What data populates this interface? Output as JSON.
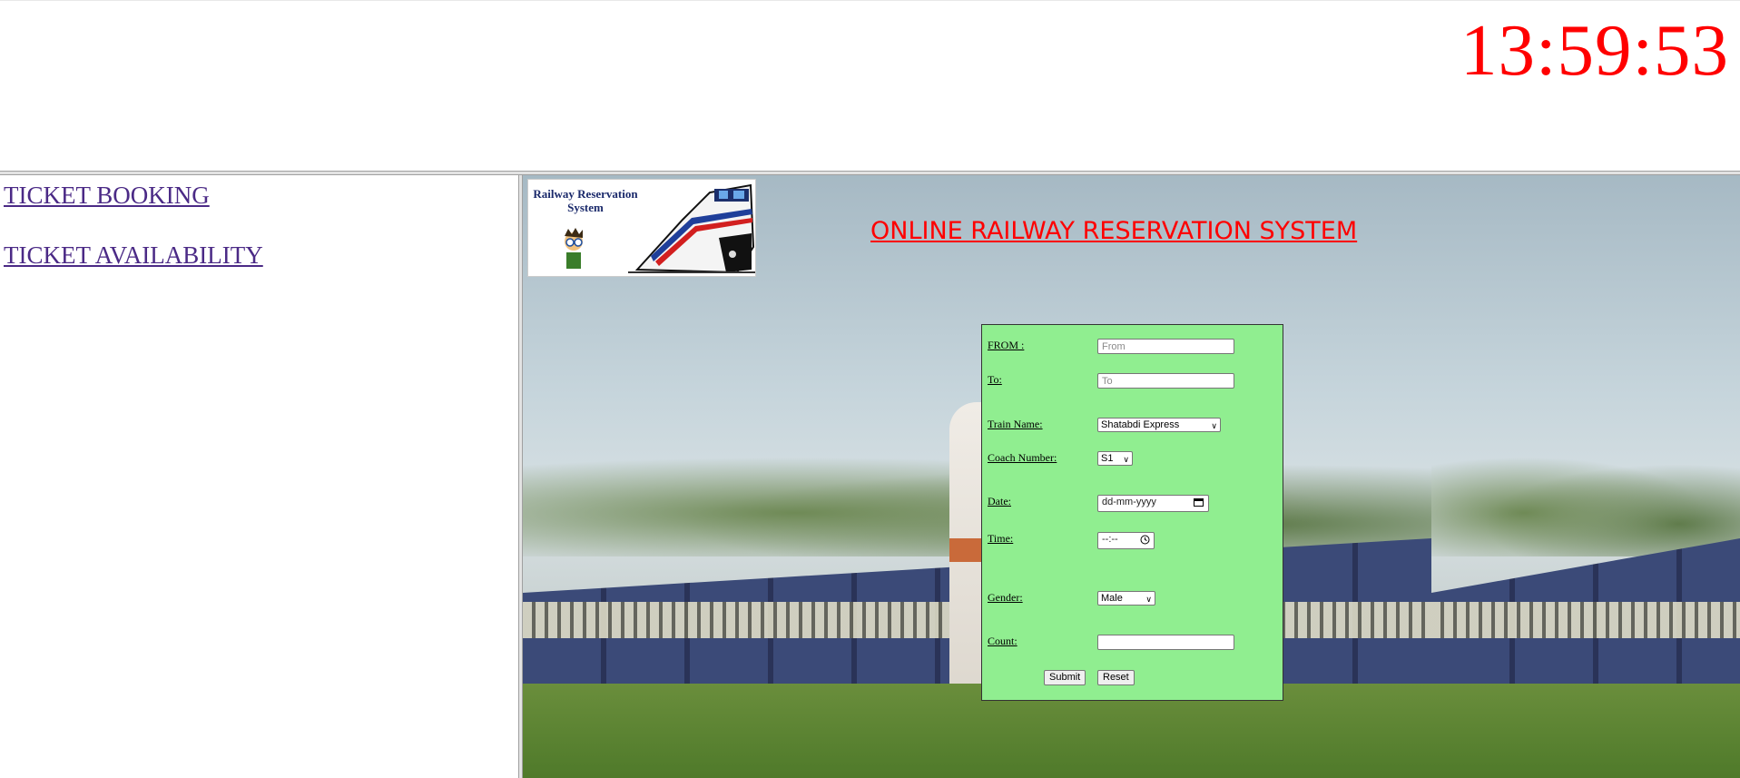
{
  "header": {
    "clock": "13:59:53"
  },
  "nav": {
    "booking": "TICKET BOOKING",
    "availability": "TICKET AVAILABILITY"
  },
  "main": {
    "logo_title": "Railway Reservation System",
    "title": "ONLINE RAILWAY RESERVATION SYSTEM"
  },
  "form": {
    "from_label": "FROM :",
    "from_placeholder": "From",
    "to_label": "To:",
    "to_placeholder": "To",
    "train_label": "Train Name:",
    "train_value": "Shatabdi Express",
    "coach_label": "Coach Number:",
    "coach_value": "S1",
    "date_label": "Date:",
    "date_placeholder": "dd-mm-yyyy",
    "time_label": "Time:",
    "time_placeholder": "--:--",
    "gender_label": "Gender:",
    "gender_value": "Male",
    "count_label": "Count:",
    "count_value": "",
    "submit": "Submit",
    "reset": "Reset"
  },
  "colors": {
    "clock": "#ff0000",
    "title": "#ff0000",
    "nav_link": "#4b2a86",
    "form_bg": "#90ee90"
  }
}
